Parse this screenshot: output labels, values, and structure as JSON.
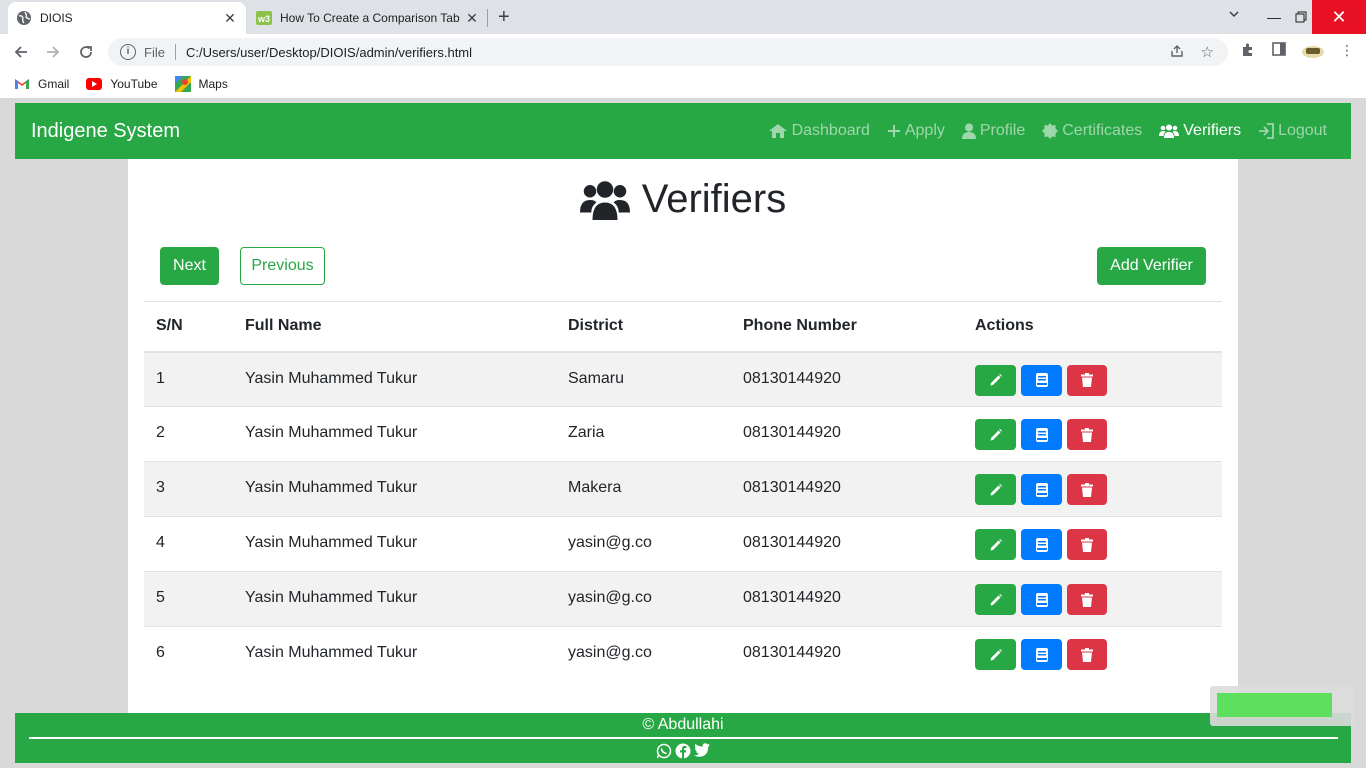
{
  "browser": {
    "tabs": [
      {
        "title": "DIOIS",
        "active": true
      },
      {
        "title": "How To Create a Comparison Tab",
        "active": false
      }
    ],
    "address": {
      "scheme": "File",
      "url": "C:/Users/user/Desktop/DIOIS/admin/verifiers.html"
    },
    "bookmarks": [
      {
        "label": "Gmail",
        "icon": "gmail-icon"
      },
      {
        "label": "YouTube",
        "icon": "youtube-icon"
      },
      {
        "label": "Maps",
        "icon": "maps-icon"
      }
    ]
  },
  "navbar": {
    "brand": "Indigene System",
    "links": [
      {
        "label": "Dashboard",
        "icon": "home-icon",
        "active": false
      },
      {
        "label": "Apply",
        "icon": "plus-icon",
        "active": false
      },
      {
        "label": "Profile",
        "icon": "user-icon",
        "active": false
      },
      {
        "label": "Certificates",
        "icon": "certificate-icon",
        "active": false
      },
      {
        "label": "Verifiers",
        "icon": "users-icon",
        "active": true
      },
      {
        "label": "Logout",
        "icon": "logout-icon",
        "active": false
      }
    ]
  },
  "page": {
    "title": "Verifiers",
    "next_label": "Next",
    "previous_label": "Previous",
    "add_label": "Add Verifier"
  },
  "table": {
    "headers": [
      "S/N",
      "Full Name",
      "District",
      "Phone Number",
      "Actions"
    ],
    "rows": [
      {
        "sn": "1",
        "name": "Yasin Muhammed Tukur",
        "district": "Samaru",
        "phone": "08130144920"
      },
      {
        "sn": "2",
        "name": "Yasin Muhammed Tukur",
        "district": "Zaria",
        "phone": "08130144920"
      },
      {
        "sn": "3",
        "name": "Yasin Muhammed Tukur",
        "district": "Makera",
        "phone": "08130144920"
      },
      {
        "sn": "4",
        "name": "Yasin Muhammed Tukur",
        "district": "yasin@g.co",
        "phone": "08130144920"
      },
      {
        "sn": "5",
        "name": "Yasin Muhammed Tukur",
        "district": "yasin@g.co",
        "phone": "08130144920"
      },
      {
        "sn": "6",
        "name": "Yasin Muhammed Tukur",
        "district": "yasin@g.co",
        "phone": "08130144920"
      }
    ]
  },
  "footer": {
    "copyright": "© Abdullahi",
    "social": [
      "whatsapp-icon",
      "facebook-icon",
      "twitter-icon"
    ]
  },
  "colors": {
    "brand_green": "#28a745",
    "primary_blue": "#007bff",
    "danger_red": "#dc3545"
  }
}
